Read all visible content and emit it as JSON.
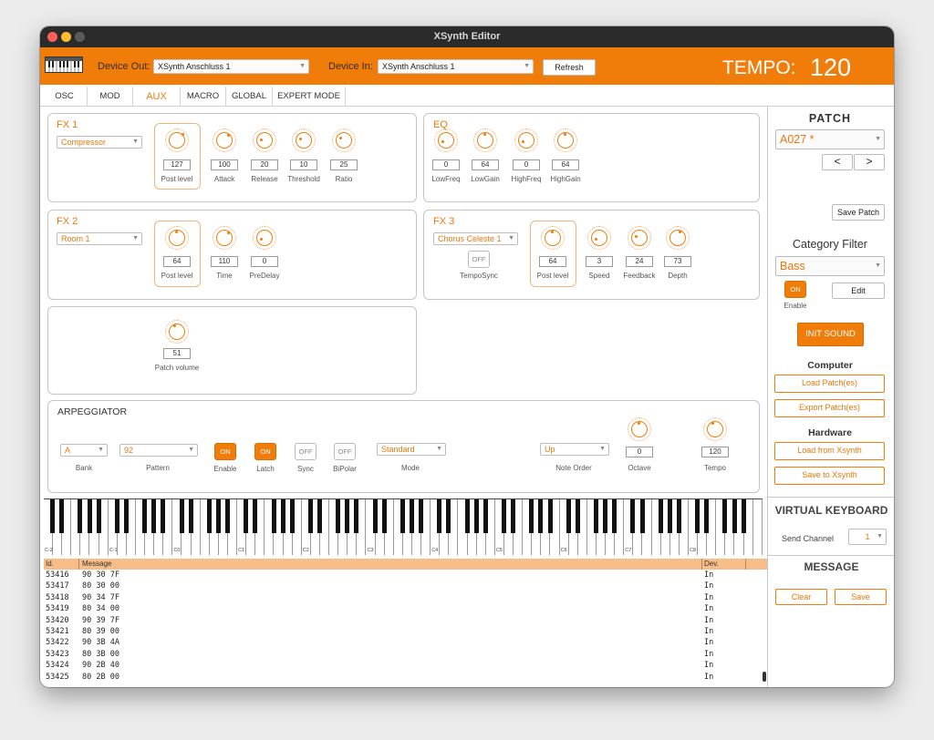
{
  "window": {
    "title": "XSynth Editor"
  },
  "toolbar": {
    "device_out_label": "Device Out:",
    "device_out_value": "XSynth Anschluss 1",
    "device_in_label": "Device In:",
    "device_in_value": "XSynth Anschluss 1",
    "refresh_label": "Refresh",
    "tempo_label": "TEMPO:",
    "tempo_value": "120"
  },
  "tabs": [
    "OSC",
    "MOD",
    "AUX",
    "MACRO",
    "GLOBAL",
    "EXPERT MODE"
  ],
  "fx1": {
    "title": "FX 1",
    "type": "Compressor",
    "knobs": [
      {
        "label": "Post level",
        "value": "127"
      },
      {
        "label": "Attack",
        "value": "100"
      },
      {
        "label": "Release",
        "value": "20"
      },
      {
        "label": "Threshold",
        "value": "10"
      },
      {
        "label": "Ratio",
        "value": "25"
      }
    ]
  },
  "eq": {
    "title": "EQ",
    "knobs": [
      {
        "label": "LowFreq",
        "value": "0"
      },
      {
        "label": "LowGain",
        "value": "64"
      },
      {
        "label": "HighFreq",
        "value": "0"
      },
      {
        "label": "HighGain",
        "value": "64"
      }
    ]
  },
  "fx2": {
    "title": "FX 2",
    "type": "Room 1",
    "knobs": [
      {
        "label": "Post level",
        "value": "64"
      },
      {
        "label": "Time",
        "value": "110"
      },
      {
        "label": "PreDelay",
        "value": "0"
      }
    ]
  },
  "fx3": {
    "title": "FX 3",
    "type": "Chorus Celeste 1",
    "temposync_state": "OFF",
    "temposync_label": "TempoSync",
    "knobs": [
      {
        "label": "Post level",
        "value": "64"
      },
      {
        "label": "Speed",
        "value": "3"
      },
      {
        "label": "Feedback",
        "value": "24"
      },
      {
        "label": "Depth",
        "value": "73"
      }
    ]
  },
  "volume": {
    "label": "Patch volume",
    "value": "51"
  },
  "arp": {
    "title": "ARPEGGIATOR",
    "bank_value": "A",
    "bank_label": "Bank",
    "pattern_value": "92",
    "pattern_label": "Pattern",
    "enable_state": "ON",
    "enable_label": "Enable",
    "latch_state": "ON",
    "latch_label": "Latch",
    "sync_state": "OFF",
    "sync_label": "Sync",
    "bipolar_state": "OFF",
    "bipolar_label": "BiPolar",
    "mode_value": "Standard",
    "mode_label": "Mode",
    "noteorder_value": "Up",
    "noteorder_label": "Note Order",
    "octave_value": "0",
    "octave_label": "Octave",
    "tempo_value": "120",
    "tempo_label": "Tempo"
  },
  "sidebar": {
    "patch_title": "PATCH",
    "patch_value": "A027 *",
    "prev_label": "<",
    "next_label": ">",
    "save_patch_label": "Save Patch",
    "category_title": "Category Filter",
    "category_value": "Bass",
    "enable_state": "ON",
    "enable_label": "Enable",
    "edit_label": "Edit",
    "init_sound_label": "INIT SOUND",
    "computer_title": "Computer",
    "load_patches_label": "Load Patch(es)",
    "export_patches_label": "Export Patch(es)",
    "hardware_title": "Hardware",
    "load_from_label": "Load from Xsynth",
    "save_to_label": "Save to Xsynth",
    "vk_title": "VIRTUAL KEYBOARD",
    "send_channel_label": "Send Channel",
    "send_channel_value": "1",
    "message_title": "MESSAGE",
    "clear_label": "Clear",
    "save_label": "Save"
  },
  "keyboard": {
    "octave_labels": [
      "C-2",
      "C-1",
      "C0",
      "C1",
      "C2",
      "C3",
      "C4",
      "C5",
      "C6",
      "C7",
      "C8"
    ]
  },
  "messages": {
    "columns": [
      "Id.",
      "Message",
      "Dev."
    ],
    "rows": [
      {
        "id": "53416",
        "msg": "90 30 7F",
        "dev": "In"
      },
      {
        "id": "53417",
        "msg": "80 30 00",
        "dev": "In"
      },
      {
        "id": "53418",
        "msg": "90 34 7F",
        "dev": "In"
      },
      {
        "id": "53419",
        "msg": "80 34 00",
        "dev": "In"
      },
      {
        "id": "53420",
        "msg": "90 39 7F",
        "dev": "In"
      },
      {
        "id": "53421",
        "msg": "80 39 00",
        "dev": "In"
      },
      {
        "id": "53422",
        "msg": "90 3B 4A",
        "dev": "In"
      },
      {
        "id": "53423",
        "msg": "80 3B 00",
        "dev": "In"
      },
      {
        "id": "53424",
        "msg": "90 2B 40",
        "dev": "In"
      },
      {
        "id": "53425",
        "msg": "80 2B 00",
        "dev": "In"
      }
    ]
  },
  "colors": {
    "accent": "#f07d0a",
    "titlebar": "#2b2b2b",
    "table_header": "#f6bd88"
  }
}
